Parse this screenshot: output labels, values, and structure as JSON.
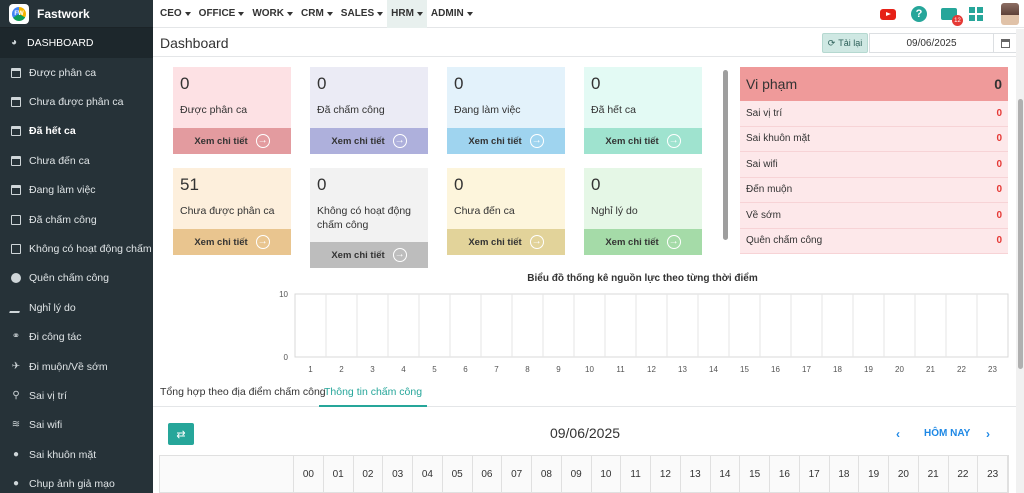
{
  "app": {
    "name": "Fastwork"
  },
  "sidebar": {
    "dashboard": "DASHBOARD",
    "items": [
      {
        "label": "Được phân ca",
        "icon": "calendar-icon"
      },
      {
        "label": "Chưa được phân ca",
        "icon": "calendar-icon"
      },
      {
        "label": "Đã hết ca",
        "icon": "calendar-icon"
      },
      {
        "label": "Chưa đến ca",
        "icon": "calendar-icon"
      },
      {
        "label": "Đang làm việc",
        "icon": "calendar-icon"
      },
      {
        "label": "Đã chấm công",
        "icon": "check-square-icon"
      },
      {
        "label": "Không có hoạt động chấm công",
        "icon": "square-icon"
      },
      {
        "label": "Quên chấm công",
        "icon": "exclamation-circle-icon"
      },
      {
        "label": "Nghỉ lý do",
        "icon": "edit-icon"
      },
      {
        "label": "Đi công tác",
        "icon": "handshake-icon"
      },
      {
        "label": "Đi muộn/Về sớm",
        "icon": "walking-icon"
      },
      {
        "label": "Sai vị trí",
        "icon": "street-view-icon"
      },
      {
        "label": "Sai wifi",
        "icon": "wifi-icon"
      },
      {
        "label": "Sai khuôn mặt",
        "icon": "user-icon"
      },
      {
        "label": "Chụp ảnh giả mạo",
        "icon": "user-secret-icon"
      }
    ]
  },
  "topmenu": [
    {
      "label": "CEO"
    },
    {
      "label": "OFFICE"
    },
    {
      "label": "WORK"
    },
    {
      "label": "CRM"
    },
    {
      "label": "SALES"
    },
    {
      "label": "HRM"
    },
    {
      "label": "ADMIN"
    }
  ],
  "notifications": {
    "mail_count": "12"
  },
  "header": {
    "title": "Dashboard",
    "reload_label": "Tải lại",
    "date": "09/06/2025"
  },
  "cards": [
    {
      "value": "0",
      "label": "Được phân ca",
      "link": "Xem chi tiết"
    },
    {
      "value": "0",
      "label": "Đã chấm công",
      "link": "Xem chi tiết"
    },
    {
      "value": "0",
      "label": "Đang làm việc",
      "link": "Xem chi tiết"
    },
    {
      "value": "0",
      "label": "Đã hết ca",
      "link": "Xem chi tiết"
    },
    {
      "value": "51",
      "label": "Chưa được phân ca",
      "link": "Xem chi tiết"
    },
    {
      "value": "0",
      "label": "Không có hoạt động chấm công",
      "link": "Xem chi tiết"
    },
    {
      "value": "0",
      "label": "Chưa đến ca",
      "link": "Xem chi tiết"
    },
    {
      "value": "0",
      "label": "Nghỉ lý do",
      "link": "Xem chi tiết"
    }
  ],
  "violations": {
    "title": "Vi phạm",
    "total": "0",
    "rows": [
      {
        "label": "Sai vị trí",
        "value": "0"
      },
      {
        "label": "Sai khuôn mặt",
        "value": "0"
      },
      {
        "label": "Sai wifi",
        "value": "0"
      },
      {
        "label": "Đến muộn",
        "value": "0"
      },
      {
        "label": "Về sớm",
        "value": "0"
      },
      {
        "label": "Quên chấm công",
        "value": "0"
      }
    ]
  },
  "chart_data": {
    "type": "bar",
    "title": "Biểu đồ thống kê nguồn lực theo từng thời điểm",
    "categories": [
      "1",
      "2",
      "3",
      "4",
      "5",
      "6",
      "7",
      "8",
      "9",
      "10",
      "11",
      "12",
      "13",
      "14",
      "15",
      "16",
      "17",
      "18",
      "19",
      "20",
      "21",
      "22",
      "23"
    ],
    "values": [
      0,
      0,
      0,
      0,
      0,
      0,
      0,
      0,
      0,
      0,
      0,
      0,
      0,
      0,
      0,
      0,
      0,
      0,
      0,
      0,
      0,
      0,
      0
    ],
    "ylim": [
      0,
      10
    ],
    "yticks": [
      "0",
      "10"
    ],
    "grid": true
  },
  "tabs": [
    {
      "label": "Tổng hợp theo địa điểm chấm công"
    },
    {
      "label": "Thông tin chấm công"
    }
  ],
  "timesheet": {
    "date": "09/06/2025",
    "today_label": "HÔM NAY",
    "hours": [
      "00",
      "01",
      "02",
      "03",
      "04",
      "05",
      "06",
      "07",
      "08",
      "09",
      "10",
      "11",
      "12",
      "13",
      "14",
      "15",
      "16",
      "17",
      "18",
      "19",
      "20",
      "21",
      "22",
      "23"
    ]
  }
}
